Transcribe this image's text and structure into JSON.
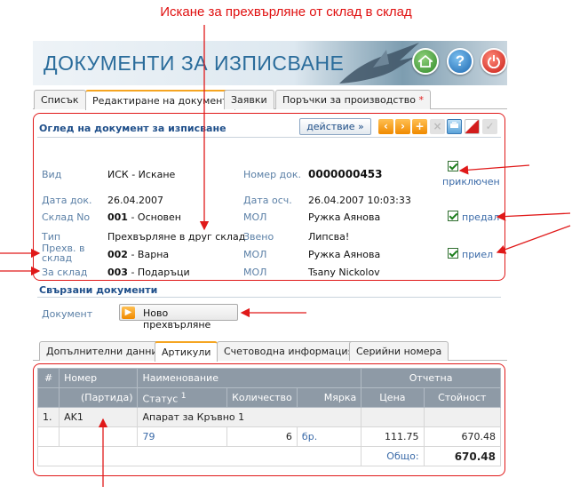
{
  "callout": {
    "title": "Искане за прехвърляне от склад в склад"
  },
  "header": {
    "title": "ДОКУМЕНТИ ЗА ИЗПИСВАНЕ",
    "help_glyph": "?"
  },
  "main_tabs": [
    {
      "label": "Списък"
    },
    {
      "label": "Редактиране на документ"
    },
    {
      "label": "Заявки"
    },
    {
      "label": "Поръчки за производство",
      "marker": "*"
    }
  ],
  "doc_view": {
    "title": "Оглед на документ за изписване",
    "action_label": "действие »",
    "fields": {
      "vid": {
        "label": "Вид",
        "value": "ИСК - Искане"
      },
      "doc_no": {
        "label": "Номер док.",
        "value": "0000000453"
      },
      "doc_date": {
        "label": "Дата док.",
        "value": "26.04.2007"
      },
      "acc_date": {
        "label": "Дата осч.",
        "value": "26.04.2007 10:03:33"
      },
      "warehouse": {
        "label": "Склад No",
        "code": "001",
        "name": " - Основен"
      },
      "mol1": {
        "label": "МОЛ",
        "value": "Ружка Аянова"
      },
      "type": {
        "label": "Тип",
        "value": "Прехвърляне в друг склад"
      },
      "unit": {
        "label": "Звено",
        "value": "Липсва!"
      },
      "transfer_from": {
        "label": "Прехв. в склад",
        "code": "002",
        "name": " - Варна"
      },
      "mol2": {
        "label": "МОЛ",
        "value": "Ружка Аянова"
      },
      "to_warehouse": {
        "label": "За склад",
        "code": "003",
        "name": " - Подаръци"
      },
      "mol3": {
        "label": "МОЛ",
        "value": "Tsany Nickolov"
      }
    },
    "checks": {
      "closed": "приключен",
      "handed": "предал",
      "received": "приел"
    }
  },
  "linked": {
    "title": "Свързани документи",
    "doc_label": "Документ",
    "new_transfer_label": "Ново прехвърляне"
  },
  "sub_tabs": [
    {
      "label": "Допълнителни данни"
    },
    {
      "label": "Артикули"
    },
    {
      "label": "Счетоводна информация"
    },
    {
      "label": "Серийни номера"
    }
  ],
  "grid": {
    "headers": {
      "hash": "#",
      "number": "Номер",
      "name": "Наименование",
      "unit_price": "Отчетна",
      "batch": "(Партида)",
      "status": "Статус",
      "status_sup": "1",
      "qty": "Количество",
      "measure": "Мярка",
      "price": "Цена",
      "value": "Стойност"
    },
    "row": {
      "index": "1.",
      "number": "AK1",
      "name": "Апарат за Кръвно 1",
      "status": "79",
      "qty": "6",
      "measure": "бр.",
      "price": "111.75",
      "value": "670.48"
    },
    "total_label": "Общо:",
    "total_value": "670.48"
  },
  "colors": {
    "accent_red": "#e01919",
    "title_blue": "#2a6c9b",
    "orange": "#f08a00"
  }
}
